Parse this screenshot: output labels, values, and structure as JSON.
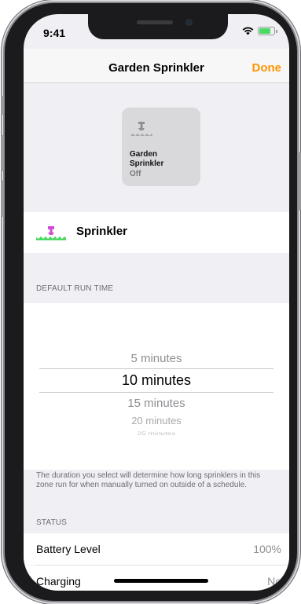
{
  "status_bar": {
    "time": "9:41",
    "wifi_icon": "wifi-icon",
    "battery_icon": "battery-charging-icon",
    "battery_color": "#4cd964"
  },
  "navbar": {
    "title": "Garden Sprinkler",
    "done_label": "Done",
    "accent_color": "#ff9500"
  },
  "tile": {
    "icon": "sprinkler-icon",
    "name": "Garden Sprinkler",
    "state": "Off"
  },
  "accessory": {
    "icon": "sprinkler-icon",
    "icon_color": "#d14bd6",
    "grass_color": "#4cd964",
    "label": "Sprinkler"
  },
  "run_time": {
    "header": "DEFAULT RUN TIME",
    "options": [
      "5 minutes",
      "10 minutes",
      "15 minutes",
      "20 minutes",
      "25 minutes"
    ],
    "selected": "10 minutes",
    "footer": "The duration you select will determine how long sprinklers in this zone run for when manually turned on outside of a schedule."
  },
  "status": {
    "header": "STATUS",
    "rows": [
      {
        "label": "Battery Level",
        "value": "100%"
      },
      {
        "label": "Charging",
        "value": "No"
      }
    ]
  }
}
